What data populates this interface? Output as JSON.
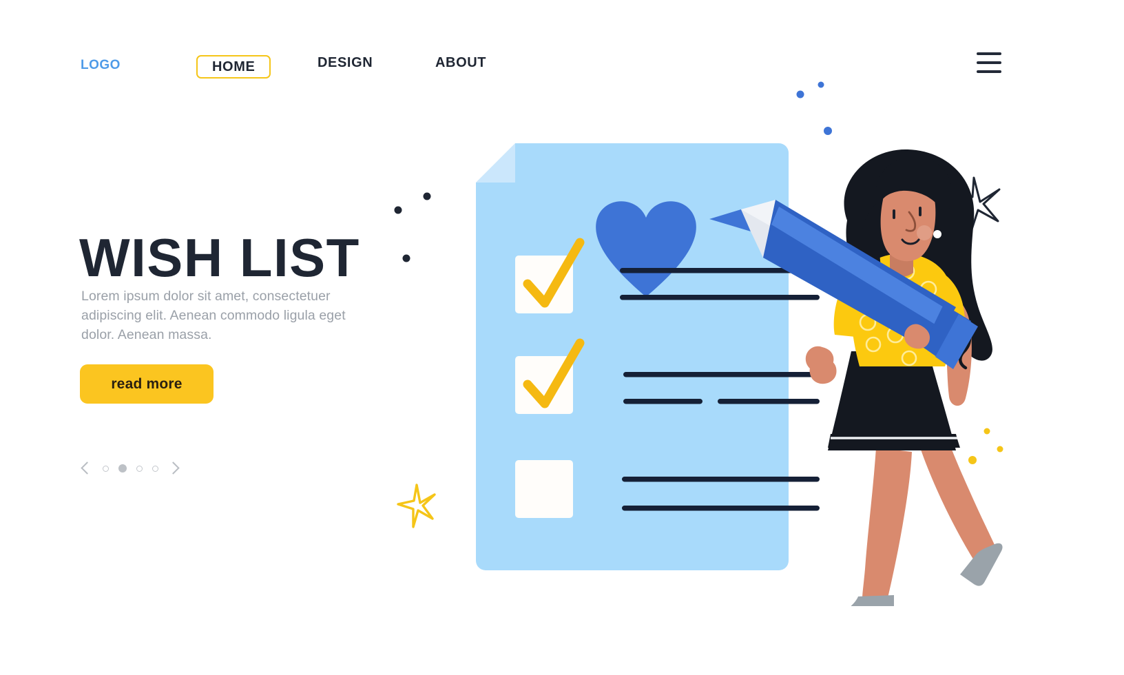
{
  "nav": {
    "logo": "LOGO",
    "items": [
      {
        "label": "HOME",
        "active": true
      },
      {
        "label": "DESIGN",
        "active": false
      },
      {
        "label": "ABOUT",
        "active": false
      }
    ],
    "menu_icon": "hamburger-icon"
  },
  "hero": {
    "title": "WISH LIST",
    "description": "Lorem ipsum dolor sit amet, consectetuer adipiscing elit. Aenean commodo ligula eget dolor. Aenean massa.",
    "cta_label": "read more"
  },
  "carousel": {
    "prev_icon": "chevron-left-icon",
    "next_icon": "chevron-right-icon",
    "dots": 4,
    "active_dot": 2
  },
  "illustration": {
    "name": "woman-with-pencil-checklist",
    "paper": {
      "name": "checklist-paper",
      "folded_corner": true,
      "heart_icon": "heart-icon",
      "items": [
        {
          "checked": true,
          "lines": 2
        },
        {
          "checked": true,
          "lines": 2
        },
        {
          "checked": false,
          "lines": 2
        }
      ]
    },
    "character": {
      "name": "woman-character",
      "holds": "blue-pencil"
    },
    "decorations": [
      "star-dark",
      "star-yellow",
      "dots-blue",
      "dots-dark",
      "dots-yellow"
    ]
  },
  "colors": {
    "accent_yellow": "#FBC520",
    "brand_blue": "#4F9BE8",
    "paper_blue": "#A8DAFB",
    "heart_blue": "#3E74D6",
    "pencil_blue": "#2F62C4",
    "text_dark": "#1F2633",
    "text_muted": "#9AA0A8",
    "background": "#FFFFFF"
  }
}
